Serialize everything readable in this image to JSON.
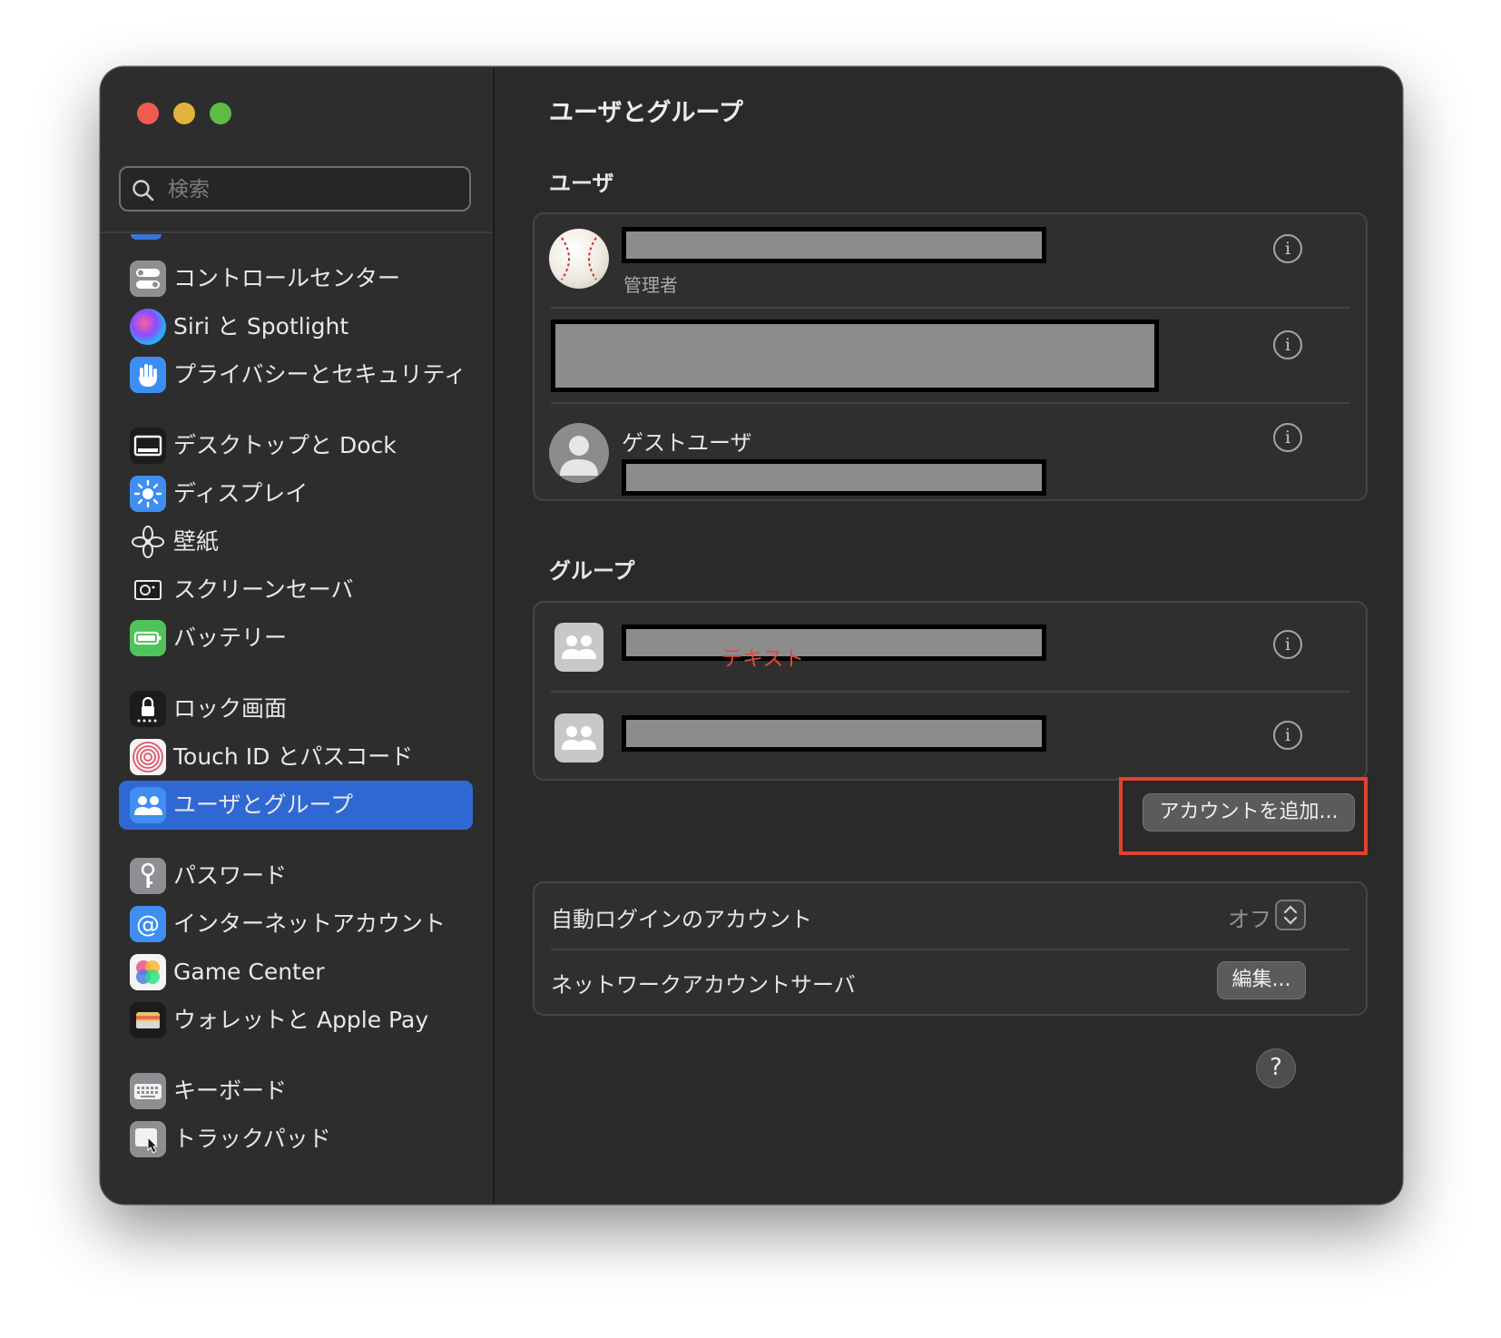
{
  "window": {
    "title": "ユーザとグループ"
  },
  "search": {
    "placeholder": "検索"
  },
  "sidebar": {
    "items": [
      {
        "label": "コントロールセンター",
        "icon": "control-center-icon"
      },
      {
        "label": "Siri と Spotlight",
        "icon": "siri-icon"
      },
      {
        "label": "プライバシーとセキュリティ",
        "icon": "hand-icon"
      },
      {
        "label": "デスクトップと Dock",
        "icon": "desktop-dock-icon"
      },
      {
        "label": "ディスプレイ",
        "icon": "display-icon"
      },
      {
        "label": "壁紙",
        "icon": "wallpaper-icon"
      },
      {
        "label": "スクリーンセーバ",
        "icon": "screensaver-icon"
      },
      {
        "label": "バッテリー",
        "icon": "battery-icon"
      },
      {
        "label": "ロック画面",
        "icon": "lock-icon"
      },
      {
        "label": "Touch ID とパスコード",
        "icon": "fingerprint-icon"
      },
      {
        "label": "ユーザとグループ",
        "icon": "users-icon",
        "active": true
      },
      {
        "label": "パスワード",
        "icon": "key-icon"
      },
      {
        "label": "インターネットアカウント",
        "icon": "at-sign-icon"
      },
      {
        "label": "Game Center",
        "icon": "game-center-icon"
      },
      {
        "label": "ウォレットと Apple Pay",
        "icon": "wallet-icon"
      },
      {
        "label": "キーボード",
        "icon": "keyboard-icon"
      },
      {
        "label": "トラックパッド",
        "icon": "trackpad-icon"
      }
    ]
  },
  "main": {
    "title": "ユーザとグループ",
    "users_section": {
      "title": "ユーザ",
      "admin_role": "管理者",
      "guest_name": "ゲストユーザ"
    },
    "groups_section": {
      "title": "グループ",
      "overlay_text": "テキスト"
    },
    "add_account_button": "アカウントを追加...",
    "auto_login": {
      "label": "自動ログインのアカウント",
      "value": "オフ"
    },
    "network_server": {
      "label": "ネットワークアカウントサーバ",
      "button": "編集..."
    },
    "help_label": "?",
    "info_glyph": "i"
  },
  "colors": {
    "accent": "#2f68d3",
    "highlight": "#e2422f",
    "window_bg": "#2a2a2a",
    "sidebar_bg": "#2d2d2d"
  }
}
